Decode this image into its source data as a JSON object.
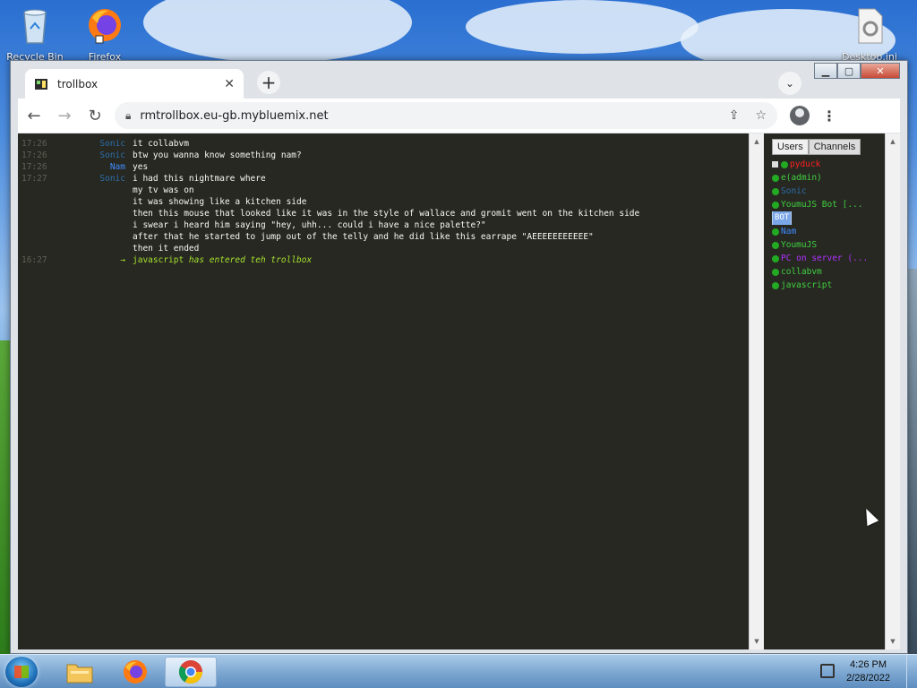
{
  "desktop": {
    "icons": [
      {
        "label": "Recycle Bin",
        "icon": "recycle-bin-icon"
      },
      {
        "label": "Firefox",
        "icon": "firefox-icon"
      },
      {
        "label": "Desktop.ini",
        "icon": "settings-file-icon"
      }
    ]
  },
  "browser": {
    "tab": {
      "title": "trollbox"
    },
    "url": "rmtrollbox.eu-gb.mybluemix.net",
    "colors": {
      "page_bg": "#272822",
      "accent_green": "#a6e22e"
    }
  },
  "chat": {
    "messages": [
      {
        "time": "17:26",
        "nick": "Sonic",
        "nick_color": "#2b6ea8",
        "text": "it collabvm"
      },
      {
        "time": "17:26",
        "nick": "Sonic",
        "nick_color": "#2b6ea8",
        "text": "btw you wanna know something nam?"
      },
      {
        "time": "17:26",
        "nick": "Nam",
        "nick_color": "#3f8cff",
        "text": "yes"
      },
      {
        "time": "17:27",
        "nick": "Sonic",
        "nick_color": "#2b6ea8",
        "text": "i had this nightmare where"
      },
      {
        "time": "",
        "nick": "",
        "nick_color": "#2b6ea8",
        "text": "my tv was on"
      },
      {
        "time": "",
        "nick": "",
        "nick_color": "#2b6ea8",
        "text": "it was showing like a kitchen side"
      },
      {
        "time": "",
        "nick": "",
        "nick_color": "#2b6ea8",
        "text": "then this mouse that looked like it was in the style of wallace and gromit went on the kitchen side"
      },
      {
        "time": "",
        "nick": "",
        "nick_color": "#2b6ea8",
        "text": "i swear i heard him saying \"hey, uhh... could i have a nice palette?\""
      },
      {
        "time": "",
        "nick": "",
        "nick_color": "#2b6ea8",
        "text": "after that he started to jump out of the telly and he did like this earrape \"AEEEEEEEEEEE\""
      },
      {
        "time": "",
        "nick": "",
        "nick_color": "#2b6ea8",
        "text": "then it ended"
      }
    ],
    "join": {
      "time": "16:27",
      "arrow": "→",
      "nick": "javascript",
      "text": "has entered teh trollbox"
    }
  },
  "users_panel": {
    "tabs": [
      "Users",
      "Channels"
    ],
    "users": [
      {
        "name": "pyduck",
        "color": "#ff2020"
      },
      {
        "name": "e(admin)",
        "color": "#40d040"
      },
      {
        "name": "Sonic",
        "color": "#2b6ea8"
      },
      {
        "name": "YoumuJS Bot [...",
        "color": "#40d040"
      },
      {
        "name": "Nam",
        "color": "#3f8cff"
      },
      {
        "name": "YoumuJS",
        "color": "#40d040"
      },
      {
        "name": "PC on server (...",
        "color": "#b030ff"
      },
      {
        "name": "collabvm",
        "color": "#40d040"
      },
      {
        "name": "javascript",
        "color": "#40d040"
      }
    ],
    "bot_badge": "BOT"
  },
  "taskbar": {
    "time": "4:26 PM",
    "date": "2/28/2022"
  }
}
